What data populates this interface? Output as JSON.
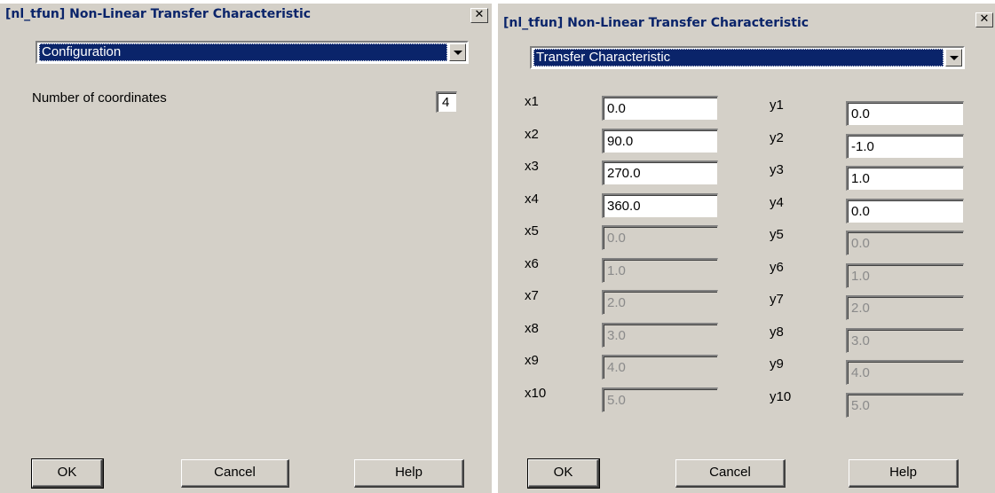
{
  "left_dialog": {
    "title": "[nl_tfun] Non-Linear Transfer Characteristic",
    "combo_value": "Configuration",
    "num_coords_label": "Number of coordinates",
    "num_coords_value": "4",
    "buttons": {
      "ok": "OK",
      "cancel": "Cancel",
      "help": "Help"
    }
  },
  "right_dialog": {
    "title": "[nl_tfun] Non-Linear Transfer Characteristic",
    "combo_value": "Transfer Characteristic",
    "x_fields": [
      {
        "label": "x1",
        "value": "0.0"
      },
      {
        "label": "x2",
        "value": "90.0"
      },
      {
        "label": "x3",
        "value": "270.0"
      },
      {
        "label": "x4",
        "value": "360.0"
      },
      {
        "label": "x5",
        "value": "0.0"
      },
      {
        "label": "x6",
        "value": "1.0"
      },
      {
        "label": "x7",
        "value": "2.0"
      },
      {
        "label": "x8",
        "value": "3.0"
      },
      {
        "label": "x9",
        "value": "4.0"
      },
      {
        "label": "x10",
        "value": "5.0"
      }
    ],
    "y_fields": [
      {
        "label": "y1",
        "value": "0.0"
      },
      {
        "label": "y2",
        "value": "-1.0"
      },
      {
        "label": "y3",
        "value": "1.0"
      },
      {
        "label": "y4",
        "value": "0.0"
      },
      {
        "label": "y5",
        "value": "0.0"
      },
      {
        "label": "y6",
        "value": "1.0"
      },
      {
        "label": "y7",
        "value": "2.0"
      },
      {
        "label": "y8",
        "value": "3.0"
      },
      {
        "label": "y9",
        "value": "4.0"
      },
      {
        "label": "y10",
        "value": "5.0"
      }
    ],
    "buttons": {
      "ok": "OK",
      "cancel": "Cancel",
      "help": "Help"
    }
  },
  "close_glyph": "✕",
  "colors": {
    "dialog_bg": "#d4d0c8",
    "title_text": "#0a246a",
    "selection_bg": "#0a246a",
    "disabled_text": "#8a8a8a"
  }
}
